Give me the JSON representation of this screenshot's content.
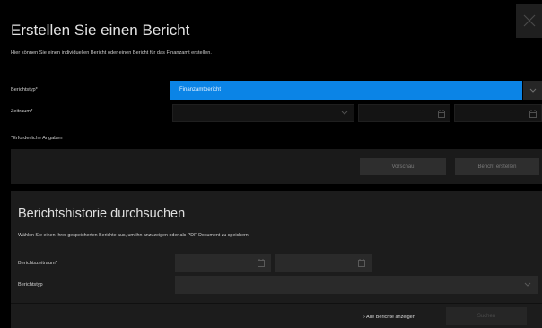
{
  "dialog": {
    "title": "Erstellen Sie einen Bericht",
    "intro": "Hier können Sie einen individuellen Bericht oder einen Bericht für das Finanzamt erstellen.",
    "close_icon": "close-icon"
  },
  "form": {
    "report_type_label": "Berichtstyp*",
    "report_type_value": "Finanzamtbericht",
    "period_label": "Zeitraum*",
    "period_value": "",
    "period_from": "",
    "period_to": "",
    "required_note": "*Erforderliche Angaben"
  },
  "actions": {
    "preview_label": "Vorschau",
    "create_label": "Bericht erstellen"
  },
  "history": {
    "title": "Berichtshistorie durchsuchen",
    "intro": "Wählen Sie einen Ihrer gespeicherten Berichte aus, um ihn anzuzeigen oder als PDF-Dokument zu speichern.",
    "period_label": "Berichtszeitraum*",
    "type_label": "Berichtstyp",
    "period_from": "",
    "period_to": "",
    "type_value": "",
    "all_reports_link": "› Alle Berichte anzeigen",
    "search_label": "Suchen"
  },
  "colors": {
    "accent": "#0b84e6",
    "background": "#000000",
    "panel": "#1c1c1c"
  }
}
